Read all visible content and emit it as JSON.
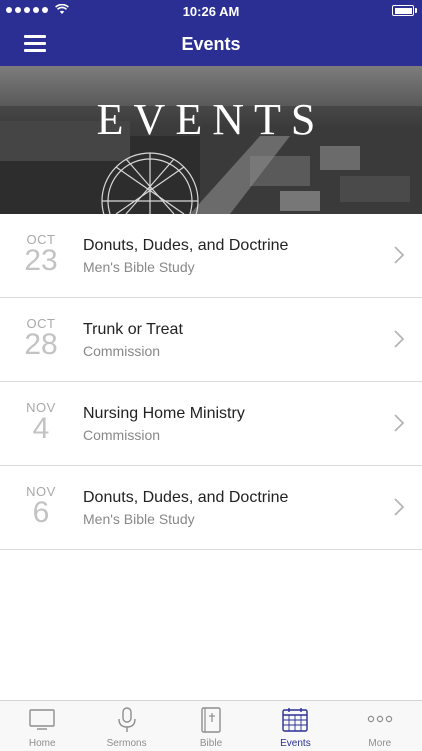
{
  "status_bar": {
    "time": "10:26 AM"
  },
  "header": {
    "title": "Events"
  },
  "hero": {
    "title": "EVENTS"
  },
  "events": [
    {
      "month": "OCT",
      "day": "23",
      "title": "Donuts, Dudes, and Doctrine",
      "subtitle": "Men's Bible Study"
    },
    {
      "month": "OCT",
      "day": "28",
      "title": "Trunk or Treat",
      "subtitle": "Commission"
    },
    {
      "month": "NOV",
      "day": "4",
      "title": "Nursing Home Ministry",
      "subtitle": "Commission"
    },
    {
      "month": "NOV",
      "day": "6",
      "title": "Donuts, Dudes, and Doctrine",
      "subtitle": "Men's Bible Study"
    }
  ],
  "tab_bar": {
    "active": "Events",
    "tabs": [
      {
        "label": "Home",
        "icon": "tv-icon"
      },
      {
        "label": "Sermons",
        "icon": "microphone-icon"
      },
      {
        "label": "Bible",
        "icon": "bible-icon"
      },
      {
        "label": "Events",
        "icon": "calendar-icon"
      },
      {
        "label": "More",
        "icon": "more-icon"
      }
    ]
  },
  "colors": {
    "brand": "#2b2f94",
    "tab_inactive": "#8e8e8e"
  }
}
